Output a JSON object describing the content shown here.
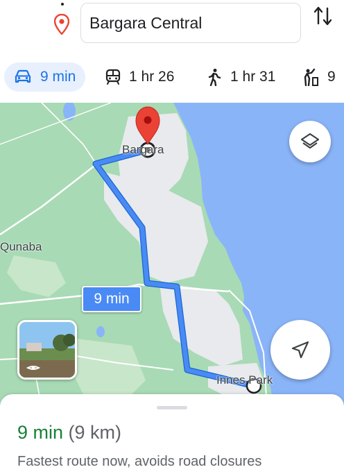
{
  "search": {
    "destination": "Bargara Central"
  },
  "modes": [
    {
      "icon": "car-icon",
      "label": "9 min",
      "active": true
    },
    {
      "icon": "train-icon",
      "label": "1 hr 26",
      "active": false
    },
    {
      "icon": "walk-icon",
      "label": "1 hr 31",
      "active": false
    },
    {
      "icon": "rideshare-icon",
      "label": "9",
      "active": false
    }
  ],
  "map": {
    "labels": {
      "destination": "Bargara",
      "suburb": "Qunaba",
      "origin": "Innes Park"
    },
    "route_time": "9 min",
    "colors": {
      "route": "#4a8af4",
      "water": "#8ab4f8",
      "land": "#a8dab5",
      "urban": "#e8eaed",
      "pin": "#ea4335"
    }
  },
  "sheet": {
    "duration": "9 min",
    "distance": "(9 km)",
    "subtitle": "Fastest route now, avoids road closures",
    "duration_color": "#188038"
  }
}
